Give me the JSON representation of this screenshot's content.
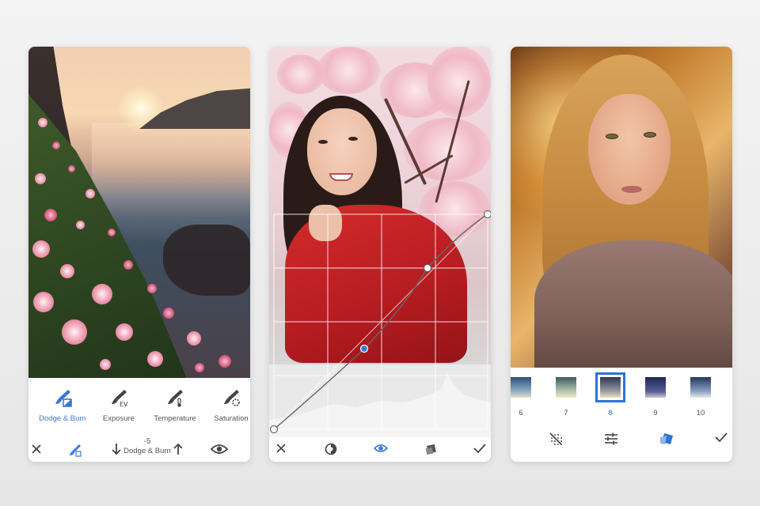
{
  "screen1": {
    "tools": [
      {
        "label": "Dodge & Burn",
        "icon": "dodge-burn-brush-icon",
        "active": true
      },
      {
        "label": "Exposure",
        "icon": "exposure-brush-icon",
        "active": false
      },
      {
        "label": "Temperature",
        "icon": "temperature-brush-icon",
        "active": false
      },
      {
        "label": "Saturation",
        "icon": "saturation-brush-icon",
        "active": false
      }
    ],
    "adjust": {
      "value": "-5",
      "label": "Dodge & Burn"
    },
    "bottom_icons": [
      "close-icon",
      "brush-icon",
      "arrow-down-icon",
      "arrow-up-icon",
      "eye-icon"
    ]
  },
  "screen2": {
    "bottom_icons": [
      "close-icon",
      "tone-curve-preset-icon",
      "eye-icon",
      "channel-icon",
      "check-icon"
    ]
  },
  "screen3": {
    "filters": [
      {
        "label": "6",
        "selected": false
      },
      {
        "label": "7",
        "selected": false
      },
      {
        "label": "8",
        "selected": true
      },
      {
        "label": "9",
        "selected": false
      },
      {
        "label": "10",
        "selected": false
      }
    ],
    "bottom_icons": [
      "grain-off-icon",
      "sliders-icon",
      "style-icon",
      "check-icon"
    ]
  },
  "colors": {
    "accent": "#3a78d6",
    "icon": "#444444"
  }
}
